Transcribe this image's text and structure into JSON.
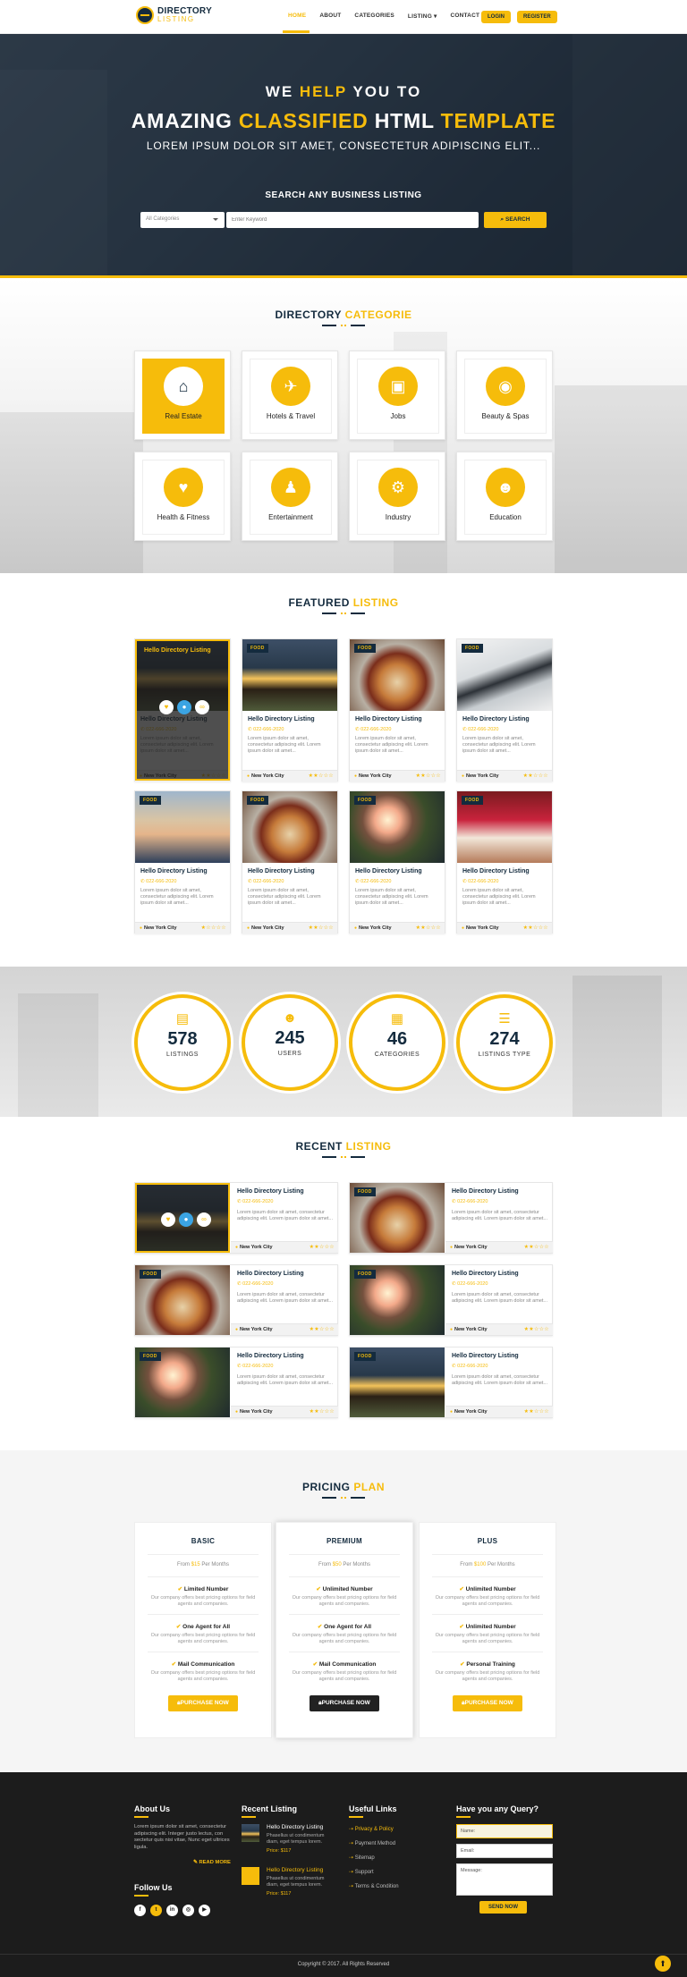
{
  "brand": {
    "line1": "DIRECTORY",
    "line2": "LISTING",
    "accent": "#f6bc0b",
    "navy": "#142b3e"
  },
  "nav": {
    "items": [
      "HOME",
      "ABOUT",
      "CATEGORIES",
      "LISTING",
      "CONTACT US"
    ],
    "active": "HOME",
    "login": "LOGIN",
    "register": "REGISTER"
  },
  "hero": {
    "l1a": "WE ",
    "l1b": "HELP",
    "l1c": " YOU TO",
    "l2a": "AMAZING ",
    "l2b": "CLASSIFIED",
    "l2c": " HTML ",
    "l2d": "TEMPLATE",
    "l3": "LOREM IPSUM DOLOR SIT AMET, CONSECTETUR ADIPISCING ELIT...",
    "search_title": "SEARCH ANY BUSINESS LISTING",
    "select_value": "All Categories",
    "keyword_placeholder": "Enter Keyword",
    "search_btn": "SEARCH"
  },
  "categories": {
    "title_a": "DIRECTORY ",
    "title_b": "CATEGORIE",
    "items": [
      {
        "label": "Real Estate",
        "icon": "home-icon",
        "glyph": "⌂"
      },
      {
        "label": "Hotels & Travel",
        "icon": "paper-plane-icon",
        "glyph": "✈"
      },
      {
        "label": "Jobs",
        "icon": "briefcase-icon",
        "glyph": "▣"
      },
      {
        "label": "Beauty & Spas",
        "icon": "eye-icon",
        "glyph": "◉"
      },
      {
        "label": "Health & Fitness",
        "icon": "heart-icon",
        "glyph": "♥"
      },
      {
        "label": "Entertainment",
        "icon": "person-icon",
        "glyph": "♟"
      },
      {
        "label": "Industry",
        "icon": "gears-icon",
        "glyph": "⚙"
      },
      {
        "label": "Education",
        "icon": "users-icon",
        "glyph": "☻"
      }
    ]
  },
  "featured": {
    "title_a": "FEATURED ",
    "title_b": "LISTING",
    "hover_title": "Hello Directory Listing",
    "items": [
      {
        "badge": "",
        "title": "Hello Directory Listing",
        "phone": "✆ 022-666-2020",
        "desc": "Lorem ipsum dolor sit amet, consectetur adipiscing elit. Lorem ipsum dolor sit amet...",
        "city": "New York City",
        "stars": "★★☆☆☆",
        "img": "house"
      },
      {
        "badge": "FOOD",
        "title": "Hello Directory Listing",
        "phone": "✆ 022-666-2020",
        "desc": "Lorem ipsum dolor sit amet, consectetur adipiscing elit. Lorem ipsum dolor sit amet...",
        "city": "New York City",
        "stars": "★★☆☆☆",
        "img": "house"
      },
      {
        "badge": "FOOD",
        "title": "Hello Directory Listing",
        "phone": "✆ 022-666-2020",
        "desc": "Lorem ipsum dolor sit amet, consectetur adipiscing elit. Lorem ipsum dolor sit amet...",
        "city": "New York City",
        "stars": "★★☆☆☆",
        "img": "food"
      },
      {
        "badge": "FOOD",
        "title": "Hello Directory Listing",
        "phone": "✆ 022-666-2020",
        "desc": "Lorem ipsum dolor sit amet, consectetur adipiscing elit. Lorem ipsum dolor sit amet...",
        "city": "New York City",
        "stars": "★★☆☆☆",
        "img": "laptop"
      },
      {
        "badge": "FOOD",
        "title": "Hello Directory Listing",
        "phone": "✆ 022-666-2020",
        "desc": "Lorem ipsum dolor sit amet, consectetur adipiscing elit. Lorem ipsum dolor sit amet...",
        "city": "New York City",
        "stars": "★☆☆☆☆",
        "img": "people"
      },
      {
        "badge": "FOOD",
        "title": "Hello Directory Listing",
        "phone": "✆ 022-666-2020",
        "desc": "Lorem ipsum dolor sit amet, consectetur adipiscing elit. Lorem ipsum dolor sit amet...",
        "city": "New York City",
        "stars": "★★☆☆☆",
        "img": "food"
      },
      {
        "badge": "FOOD",
        "title": "Hello Directory Listing",
        "phone": "✆ 022-666-2020",
        "desc": "Lorem ipsum dolor sit amet, consectetur adipiscing elit. Lorem ipsum dolor sit amet...",
        "city": "New York City",
        "stars": "★★☆☆☆",
        "img": "palm"
      },
      {
        "badge": "FOOD",
        "title": "Hello Directory Listing",
        "phone": "✆ 022-666-2020",
        "desc": "Lorem ipsum dolor sit amet, consectetur adipiscing elit. Lorem ipsum dolor sit amet...",
        "city": "New York City",
        "stars": "★★☆☆☆",
        "img": "icecream"
      }
    ]
  },
  "stats": [
    {
      "num": "578",
      "label": "LISTINGS",
      "icon": "file-icon",
      "glyph": "▤"
    },
    {
      "num": "245",
      "label": "USERS",
      "icon": "users-icon",
      "glyph": "☻"
    },
    {
      "num": "46",
      "label": "CATEGORIES",
      "icon": "grid-icon",
      "glyph": "▦"
    },
    {
      "num": "274",
      "label": "LISTINGS TYPE",
      "icon": "list-icon",
      "glyph": "☰"
    }
  ],
  "recent": {
    "title_a": "RECENT ",
    "title_b": "LISTING",
    "items": [
      {
        "badge": "",
        "img": "house",
        "title": "Hello Directory Listing",
        "phone": "✆ 022-666-2020",
        "desc": "Lorem ipsum dolor sit amet, consectetur adipiscing elit. Lorem ipsum dolor sit amet...",
        "city": "New York City",
        "stars": "★★☆☆☆"
      },
      {
        "badge": "FOOD",
        "img": "food",
        "title": "Hello Directory Listing",
        "phone": "✆ 022-666-2020",
        "desc": "Lorem ipsum dolor sit amet, consectetur adipiscing elit. Lorem ipsum dolor sit amet...",
        "city": "New York City",
        "stars": "★★☆☆☆"
      },
      {
        "badge": "FOOD",
        "img": "food",
        "title": "Hello Directory Listing",
        "phone": "✆ 022-666-2020",
        "desc": "Lorem ipsum dolor sit amet, consectetur adipiscing elit. Lorem ipsum dolor sit amet...",
        "city": "New York City",
        "stars": "★★☆☆☆"
      },
      {
        "badge": "FOOD",
        "img": "palm",
        "title": "Hello Directory Listing",
        "phone": "✆ 022-666-2020",
        "desc": "Lorem ipsum dolor sit amet, consectetur adipiscing elit. Lorem ipsum dolor sit amet...",
        "city": "New York City",
        "stars": "★★☆☆☆"
      },
      {
        "badge": "FOOD",
        "img": "palm",
        "title": "Hello Directory Listing",
        "phone": "✆ 022-666-2020",
        "desc": "Lorem ipsum dolor sit amet, consectetur adipiscing elit. Lorem ipsum dolor sit amet...",
        "city": "New York City",
        "stars": "★★☆☆☆"
      },
      {
        "badge": "FOOD",
        "img": "house",
        "title": "Hello Directory Listing",
        "phone": "✆ 022-666-2020",
        "desc": "Lorem ipsum dolor sit amet, consectetur adipiscing elit. Lorem ipsum dolor sit amet...",
        "city": "New York City",
        "stars": "★★☆☆☆"
      }
    ]
  },
  "pricing": {
    "title_a": "PRICING ",
    "title_b": "PLAN",
    "plans": [
      {
        "name": "BASIC",
        "price_pre": "From ",
        "price": "$15",
        "price_post": " Per Months",
        "features": [
          [
            "Limited Number",
            "Our company offers best pricing options for field agents and companies."
          ],
          [
            "One Agent for All",
            "Our company offers best pricing options for field agents and companies."
          ],
          [
            "Mail Communication",
            "Our company offers best pricing options for field agents and companies."
          ]
        ],
        "btn": "PURCHASE NOW"
      },
      {
        "name": "PREMIUM",
        "price_pre": "From ",
        "price": "$50",
        "price_post": " Per Months",
        "features": [
          [
            "Unlimited Number",
            "Our company offers best pricing options for field agents and companies."
          ],
          [
            "One Agent for All",
            "Our company offers best pricing options for field agents and companies."
          ],
          [
            "Mail Communication",
            "Our company offers best pricing options for field agents and companies."
          ]
        ],
        "btn": "PURCHASE NOW"
      },
      {
        "name": "PLUS",
        "price_pre": "From ",
        "price": "$100",
        "price_post": " Per Months",
        "features": [
          [
            "Unlimited Number",
            "Our company offers best pricing options for field agents and companies."
          ],
          [
            "Unlimited Number",
            "Our company offers best pricing options for field agents and companies."
          ],
          [
            "Personal Training",
            "Our company offers best pricing options for field agents and companies."
          ]
        ],
        "btn": "PURCHASE NOW"
      }
    ]
  },
  "footer": {
    "about_title": "About Us",
    "about_text": "Lorem ipsum dolor sit amet, consectetur adipiscing elit. Integer justo lectus, con sectetur quis nisi vitae, Nunc eget ultrices ligula.",
    "read_more": "READ MORE",
    "follow_title": "Follow Us",
    "social": [
      "f",
      "t",
      "in",
      "◎",
      "▶"
    ],
    "recent_title": "Recent Listing",
    "recent": [
      {
        "title": "Hello Directory Listing",
        "desc": "Phasellus ut condimentum diam, eget tempus lorem.",
        "price": "Price: $117"
      },
      {
        "title": "Hello Directory Listing",
        "desc": "Phasellus ut condimentum diam, eget tempus lorem.",
        "price": "Price: $117"
      }
    ],
    "links_title": "Useful Links",
    "links": [
      "Privacy & Policy",
      "Payment Method",
      "Sitemap",
      "Support",
      "Terms & Condition"
    ],
    "query_title": "Have you any Query?",
    "name_ph": "Name:",
    "email_ph": "Email:",
    "msg_ph": "Message:",
    "send": "SEND NOW",
    "copyright": "Copyright © 2017. All Rights Reserved"
  }
}
